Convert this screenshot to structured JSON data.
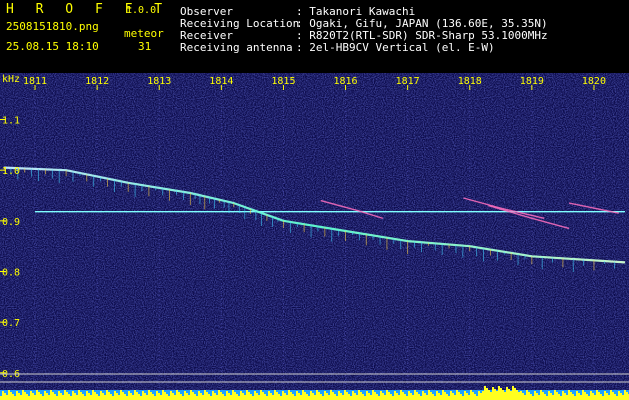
{
  "header": {
    "brand": "H R O F F T",
    "version": "1.0.0",
    "filename": "2508151810.png",
    "datetime": "25.08.15 18:10",
    "meteor_label": "meteor",
    "meteor_count": "31",
    "info": [
      {
        "label": "Observer",
        "value": ": Takanori Kawachi"
      },
      {
        "label": "Receiving Location",
        "value": ": Ogaki, Gifu, JAPAN (136.60E, 35.35N)"
      },
      {
        "label": "Receiver",
        "value": ": R820T2(RTL-SDR) SDR-Sharp 53.1000MHz"
      },
      {
        "label": "Receiving antenna",
        "value": ": 2el-HB9CV Vertical (el. E-W)"
      }
    ]
  },
  "chart_data": {
    "type": "heatmap",
    "ylabel": "kHz",
    "x_ticks": [
      "1811",
      "1812",
      "1813",
      "1814",
      "1815",
      "1816",
      "1817",
      "1818",
      "1819",
      "1820"
    ],
    "y_ticks": [
      "1.1",
      "1.0",
      "0.9",
      "0.8",
      "0.7",
      "0.6"
    ],
    "y_tick_values": [
      1.1,
      1.0,
      0.9,
      0.8,
      0.7,
      0.6
    ],
    "xlim": [
      1810.5,
      1820.5
    ],
    "ylim": [
      0.57,
      1.18
    ],
    "traces": [
      {
        "kind": "carrier",
        "x_start": 1811.0,
        "x_end": 1820.5,
        "y": 0.918
      },
      {
        "kind": "drift",
        "points": [
          [
            1810.5,
            1.005
          ],
          [
            1811.5,
            1.0
          ],
          [
            1812.5,
            0.975
          ],
          [
            1813.5,
            0.955
          ],
          [
            1814.2,
            0.935
          ],
          [
            1815.0,
            0.9
          ],
          [
            1816.0,
            0.88
          ],
          [
            1817.0,
            0.86
          ],
          [
            1818.0,
            0.85
          ],
          [
            1819.0,
            0.83
          ],
          [
            1820.5,
            0.818
          ]
        ]
      },
      {
        "kind": "meteor",
        "points": [
          [
            1815.6,
            0.94
          ],
          [
            1816.2,
            0.92
          ],
          [
            1816.6,
            0.905
          ]
        ]
      },
      {
        "kind": "meteor",
        "points": [
          [
            1817.9,
            0.945
          ],
          [
            1818.5,
            0.925
          ],
          [
            1819.2,
            0.905
          ]
        ]
      },
      {
        "kind": "meteor",
        "points": [
          [
            1818.3,
            0.93
          ],
          [
            1819.0,
            0.905
          ],
          [
            1819.6,
            0.885
          ]
        ]
      },
      {
        "kind": "meteor",
        "points": [
          [
            1819.6,
            0.935
          ],
          [
            1820.4,
            0.915
          ]
        ]
      }
    ]
  }
}
